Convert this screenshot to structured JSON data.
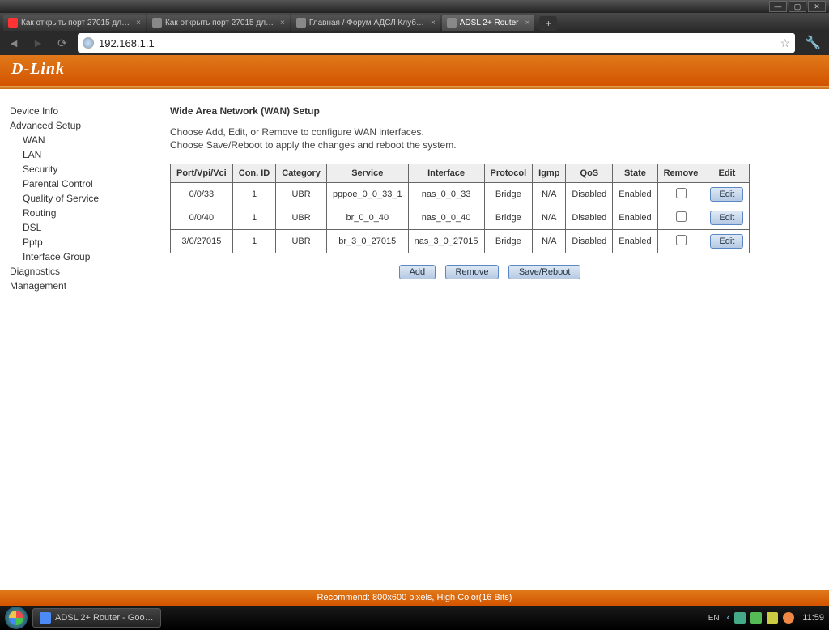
{
  "window": {
    "min": "—",
    "max": "▢",
    "close": "✕"
  },
  "tabs": [
    {
      "label": "Как открыть порт 27015 дл…",
      "fav": "y"
    },
    {
      "label": "Как открыть порт 27015 дл…",
      "fav": ""
    },
    {
      "label": "Главная / Форум АДСЛ Клуб…",
      "fav": ""
    },
    {
      "label": "ADSL 2+ Router",
      "fav": "",
      "active": true
    }
  ],
  "nav": {
    "url": "192.168.1.1"
  },
  "logo": "D-Link",
  "sidebar": {
    "items": [
      {
        "label": "Device Info",
        "sub": 0
      },
      {
        "label": "Advanced Setup",
        "sub": 0
      },
      {
        "label": "WAN",
        "sub": 1
      },
      {
        "label": "LAN",
        "sub": 1
      },
      {
        "label": "Security",
        "sub": 1
      },
      {
        "label": "Parental Control",
        "sub": 1
      },
      {
        "label": "Quality of Service",
        "sub": 1
      },
      {
        "label": "Routing",
        "sub": 1
      },
      {
        "label": "DSL",
        "sub": 1
      },
      {
        "label": "Pptp",
        "sub": 1
      },
      {
        "label": "Interface Group",
        "sub": 1
      },
      {
        "label": "Diagnostics",
        "sub": 0
      },
      {
        "label": "Management",
        "sub": 0
      }
    ]
  },
  "main": {
    "title": "Wide Area Network (WAN) Setup",
    "desc1": "Choose Add, Edit, or Remove to configure WAN interfaces.",
    "desc2": "Choose Save/Reboot to apply the changes and reboot the system.",
    "headers": [
      "Port/Vpi/Vci",
      "Con. ID",
      "Category",
      "Service",
      "Interface",
      "Protocol",
      "Igmp",
      "QoS",
      "State",
      "Remove",
      "Edit"
    ],
    "rows": [
      {
        "c": [
          "0/0/33",
          "1",
          "UBR",
          "pppoe_0_0_33_1",
          "nas_0_0_33",
          "Bridge",
          "N/A",
          "Disabled",
          "Enabled"
        ]
      },
      {
        "c": [
          "0/0/40",
          "1",
          "UBR",
          "br_0_0_40",
          "nas_0_0_40",
          "Bridge",
          "N/A",
          "Disabled",
          "Enabled"
        ]
      },
      {
        "c": [
          "3/0/27015",
          "1",
          "UBR",
          "br_3_0_27015",
          "nas_3_0_27015",
          "Bridge",
          "N/A",
          "Disabled",
          "Enabled"
        ]
      }
    ],
    "edit_label": "Edit",
    "add_label": "Add",
    "remove_label": "Remove",
    "sr_label": "Save/Reboot"
  },
  "footer": "Recommend: 800x600 pixels, High Color(16 Bits)",
  "taskbar": {
    "task": "ADSL 2+ Router - Goo…",
    "lang": "EN",
    "clock": "11:59"
  }
}
